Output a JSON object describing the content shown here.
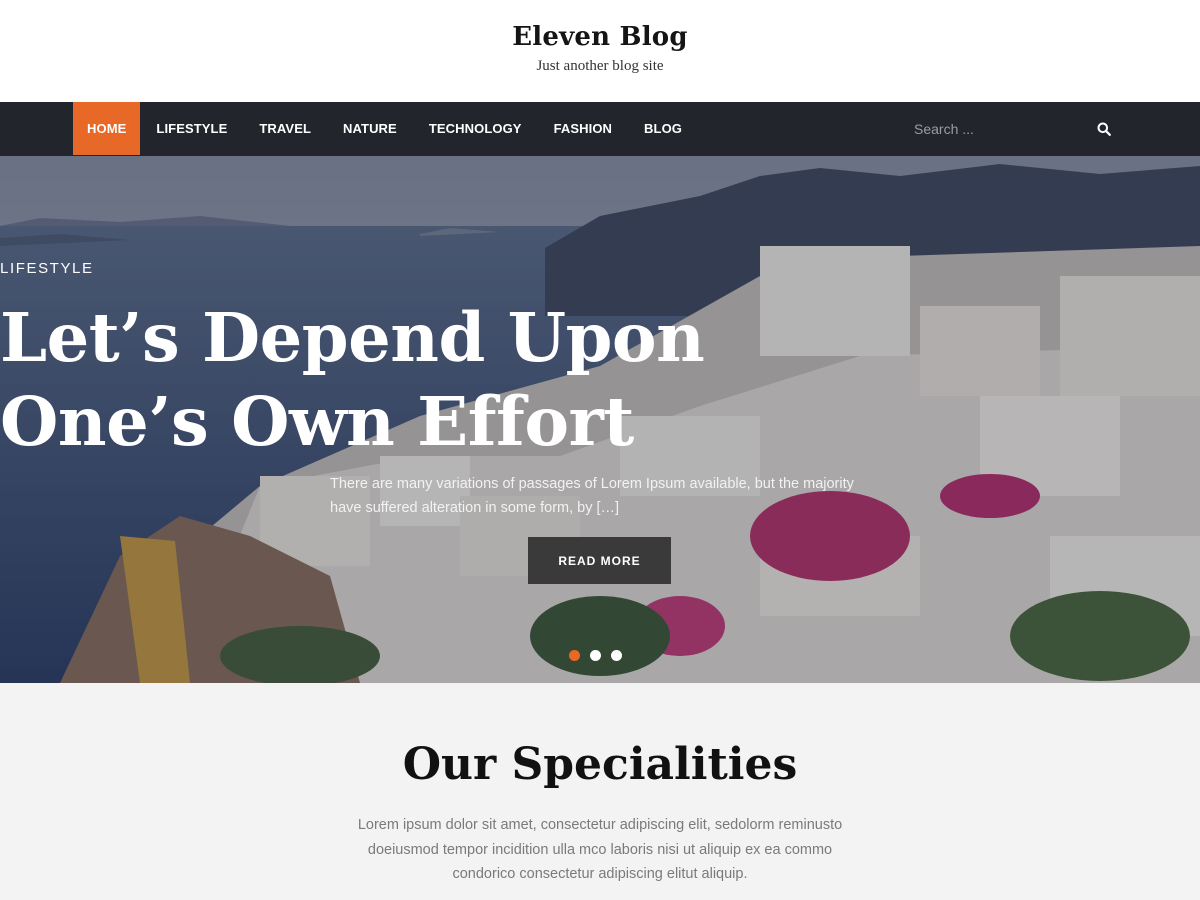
{
  "header": {
    "title": "Eleven Blog",
    "tagline": "Just another blog site"
  },
  "nav": {
    "items": [
      {
        "label": "Home",
        "active": true
      },
      {
        "label": "Lifestyle"
      },
      {
        "label": "Travel"
      },
      {
        "label": "Nature"
      },
      {
        "label": "Technology"
      },
      {
        "label": "Fashion"
      },
      {
        "label": "Blog"
      }
    ],
    "search": {
      "placeholder": "Search ...",
      "icon": "search-icon"
    },
    "accent": "#e86827",
    "background": "#22252b"
  },
  "hero": {
    "category": "LIFESTYLE",
    "title_line1": "Let’s Depend Upon",
    "title_line2": "One’s Own Effort",
    "excerpt_line1": "There are many variations of passages of Lorem Ipsum available, but the majority",
    "excerpt_line2": "have suffered alteration in some form, by […]",
    "button_label": "READ MORE",
    "slides": 3,
    "active_slide": 1
  },
  "specialities": {
    "title": "Our Specialities",
    "text_line1": "Lorem ipsum dolor sit amet, consectetur adipiscing elit, sedolorm reminusto",
    "text_line2": "doeiusmod tempor incidition ulla mco laboris nisi ut aliquip ex ea commo",
    "text_line3": "condorico consectetur adipiscing elitut aliquip."
  }
}
